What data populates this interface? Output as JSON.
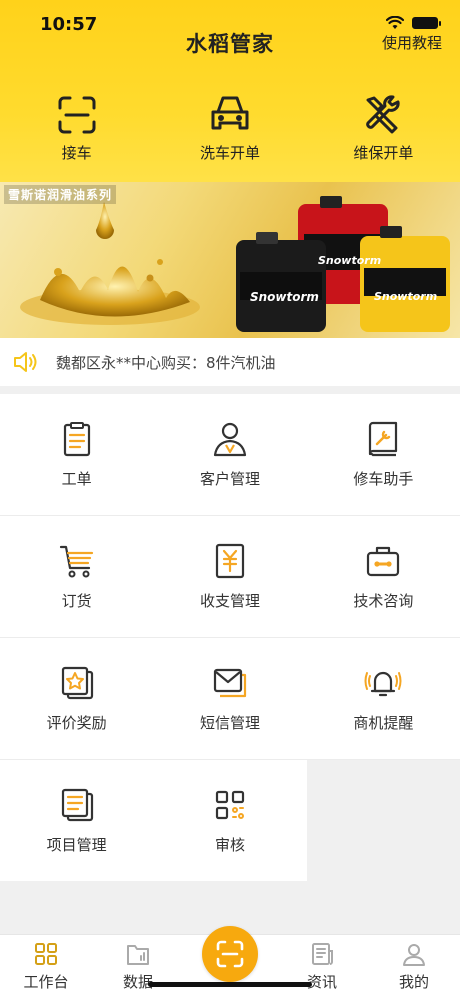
{
  "status_bar": {
    "time": "10:57"
  },
  "header": {
    "title": "水稻管家",
    "tutorial_link": "使用教程"
  },
  "quick_actions": [
    {
      "label": "接车",
      "icon": "scan-frame-icon"
    },
    {
      "label": "洗车开单",
      "icon": "car-icon"
    },
    {
      "label": "维保开单",
      "icon": "wrench-screwdriver-icon"
    }
  ],
  "banner": {
    "title": "雪斯诺润滑油系列",
    "brand": "Snowtorm"
  },
  "notice": {
    "icon": "speaker-icon",
    "text": "魏都区永**中心购买：8件汽机油"
  },
  "grid": [
    {
      "label": "工单",
      "icon": "clipboard-icon"
    },
    {
      "label": "客户管理",
      "icon": "person-icon"
    },
    {
      "label": "修车助手",
      "icon": "book-wrench-icon"
    },
    {
      "label": "订货",
      "icon": "cart-icon"
    },
    {
      "label": "收支管理",
      "icon": "yuan-document-icon"
    },
    {
      "label": "技术咨询",
      "icon": "toolbox-icon"
    },
    {
      "label": "评价奖励",
      "icon": "star-card-icon"
    },
    {
      "label": "短信管理",
      "icon": "envelope-icon"
    },
    {
      "label": "商机提醒",
      "icon": "bell-icon"
    },
    {
      "label": "项目管理",
      "icon": "list-document-icon"
    },
    {
      "label": "审核",
      "icon": "qr-code-icon"
    }
  ],
  "tabbar": {
    "items": [
      {
        "label": "工作台",
        "icon": "workbench-icon",
        "active": true
      },
      {
        "label": "数据",
        "icon": "data-folder-icon",
        "active": false
      },
      {
        "label": "资讯",
        "icon": "news-icon",
        "active": false
      },
      {
        "label": "我的",
        "icon": "profile-icon",
        "active": false
      }
    ],
    "scan_icon": "scan-icon"
  },
  "colors": {
    "accent": "#FFD21A",
    "fab": "#F7A90E",
    "icon_orange": "#F5A623",
    "icon_dark": "#333333"
  }
}
